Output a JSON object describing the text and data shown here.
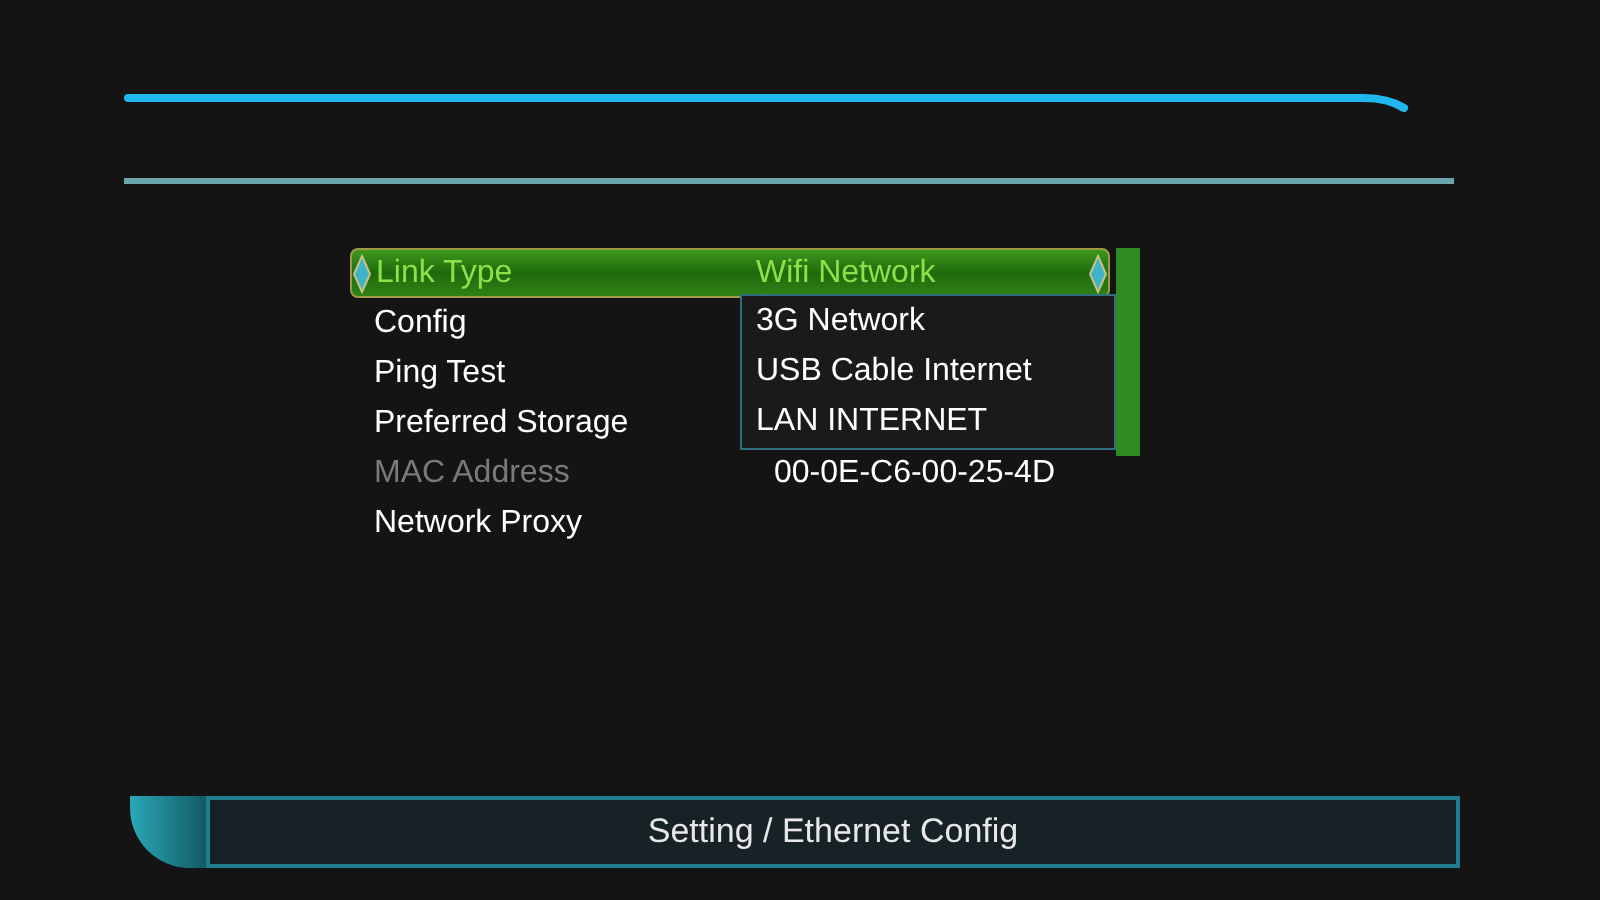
{
  "menu": {
    "items": [
      {
        "label": "Link Type",
        "value": "Wifi Network",
        "selected": true,
        "disabled": false
      },
      {
        "label": "Config",
        "selected": false,
        "disabled": false
      },
      {
        "label": "Ping Test",
        "selected": false,
        "disabled": false
      },
      {
        "label": "Preferred Storage",
        "selected": false,
        "disabled": false
      },
      {
        "label": "MAC Address",
        "value": "00-0E-C6-00-25-4D",
        "selected": false,
        "disabled": true
      },
      {
        "label": "Network Proxy",
        "selected": false,
        "disabled": false
      }
    ]
  },
  "dropdown": {
    "options": [
      "3G Network",
      "USB Cable Internet",
      "LAN INTERNET"
    ]
  },
  "status_bar": {
    "title": "Setting / Ethernet Config"
  }
}
